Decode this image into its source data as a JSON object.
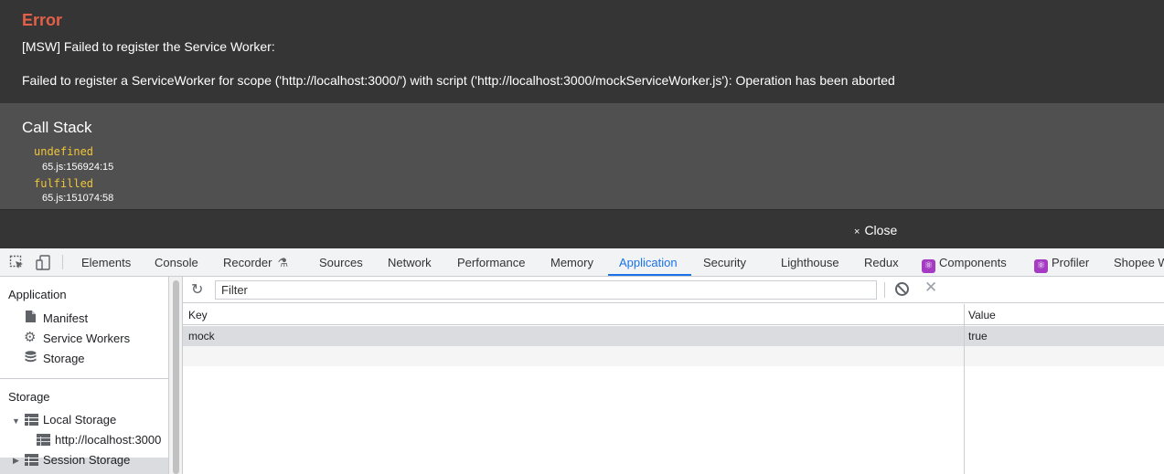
{
  "overlay": {
    "error_title": "Error",
    "message_line1": "[MSW] Failed to register the Service Worker:",
    "message_line2": "Failed to register a ServiceWorker for scope ('http://localhost:3000/') with script ('http://localhost:3000/mockServiceWorker.js'): Operation has been aborted",
    "call_stack_title": "Call Stack",
    "frames": [
      {
        "fn": "undefined",
        "loc": "65.js:156924:15"
      },
      {
        "fn": "fulfilled",
        "loc": "65.js:151074:58"
      }
    ],
    "close_label": "Close",
    "close_glyph": "×",
    "colors": {
      "error": "#e36049",
      "stack_fn": "#f0c53a",
      "bg": "#353535",
      "stack_bg": "#505050"
    }
  },
  "devtools": {
    "tabs": [
      "Elements",
      "Console",
      "Recorder",
      "Sources",
      "Network",
      "Performance",
      "Memory",
      "Application",
      "Security",
      "Lighthouse",
      "Redux",
      "Components",
      "Profiler",
      "Shopee W"
    ],
    "active_tab": "Application",
    "accent_color": "#1a73e8",
    "sidebar": {
      "application_heading": "Application",
      "application_items": [
        {
          "label": "Manifest",
          "icon": "file-icon"
        },
        {
          "label": "Service Workers",
          "icon": "gear-icon"
        },
        {
          "label": "Storage",
          "icon": "database-icon"
        }
      ],
      "storage_heading": "Storage",
      "local_storage": "Local Storage",
      "local_storage_origin": "http://localhost:3000",
      "session_storage": "Session Storage"
    },
    "toolbar": {
      "filter_placeholder": "Filter"
    },
    "table": {
      "columns": [
        "Key",
        "Value"
      ],
      "rows": [
        {
          "key": "mock",
          "value": "true"
        }
      ]
    }
  }
}
